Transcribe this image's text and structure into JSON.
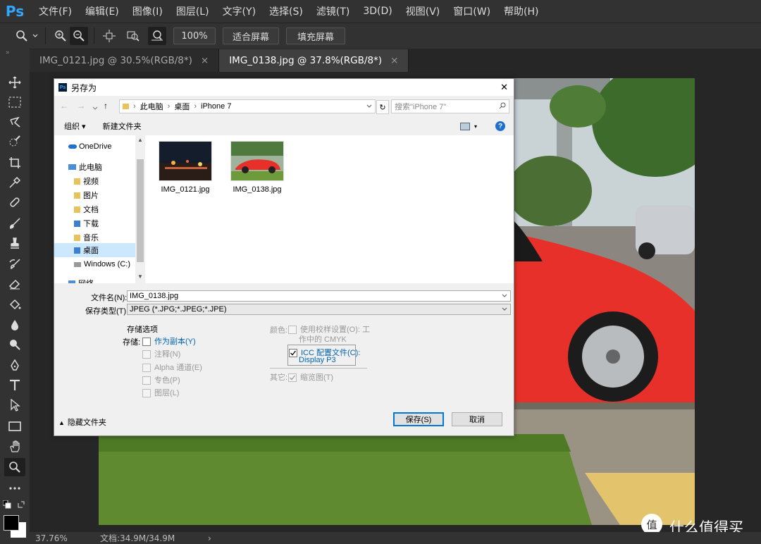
{
  "app": {
    "logo": "Ps"
  },
  "menu": [
    "文件(F)",
    "编辑(E)",
    "图像(I)",
    "图层(L)",
    "文字(Y)",
    "选择(S)",
    "滤镜(T)",
    "3D(D)",
    "视图(V)",
    "窗口(W)",
    "帮助(H)"
  ],
  "options": {
    "zoom_value": "100%",
    "fit_screen": "适合屏幕",
    "fill_screen": "填充屏幕"
  },
  "tabs": [
    {
      "label": "IMG_0121.jpg @ 30.5%(RGB/8*)",
      "close": "×"
    },
    {
      "label": "IMG_0138.jpg @ 37.8%(RGB/8*)",
      "close": "×"
    }
  ],
  "status": {
    "zoom": "37.76%",
    "doc": "文档:34.9M/34.9M",
    "arrow": "›"
  },
  "watermark": {
    "text": "什么值得买",
    "badge": "值"
  },
  "dialog": {
    "title": "另存为",
    "close": "✕",
    "breadcrumb": [
      "此电脑",
      "桌面",
      "iPhone 7"
    ],
    "search_placeholder": "搜索\"iPhone 7\"",
    "organize": "组织 ▾",
    "new_folder": "新建文件夹",
    "help": "?",
    "nav": {
      "onedrive": "OneDrive",
      "this_pc": "此电脑",
      "items": [
        "视频",
        "图片",
        "文档",
        "下载",
        "音乐",
        "桌面",
        "Windows (C:)"
      ],
      "network": "网络"
    },
    "files": [
      {
        "name": "IMG_0121.jpg"
      },
      {
        "name": "IMG_0138.jpg"
      }
    ],
    "filename_label": "文件名(N):",
    "filename_value": "IMG_0138.jpg",
    "filetype_label": "保存类型(T):",
    "filetype_value": "JPEG (*.JPG;*.JPEG;*.JPE)",
    "save_options_title": "存储选项",
    "storage_label": "存储:",
    "as_copy": "作为副本(Y)",
    "notes": "注释(N)",
    "alpha": "Alpha 通道(E)",
    "spot": "专色(P)",
    "layers": "图层(L)",
    "color_label": "颜色:",
    "use_proof_line1": "使用校样设置(O): 工",
    "use_proof_line2": "作中的 CMYK",
    "icc_line1": "ICC 配置文件(C):",
    "icc_line2": "Display P3",
    "other_label": "其它:",
    "thumbnail": "缩览图(T)",
    "hide_folders": "隐藏文件夹",
    "save": "保存(S)",
    "cancel": "取消"
  }
}
